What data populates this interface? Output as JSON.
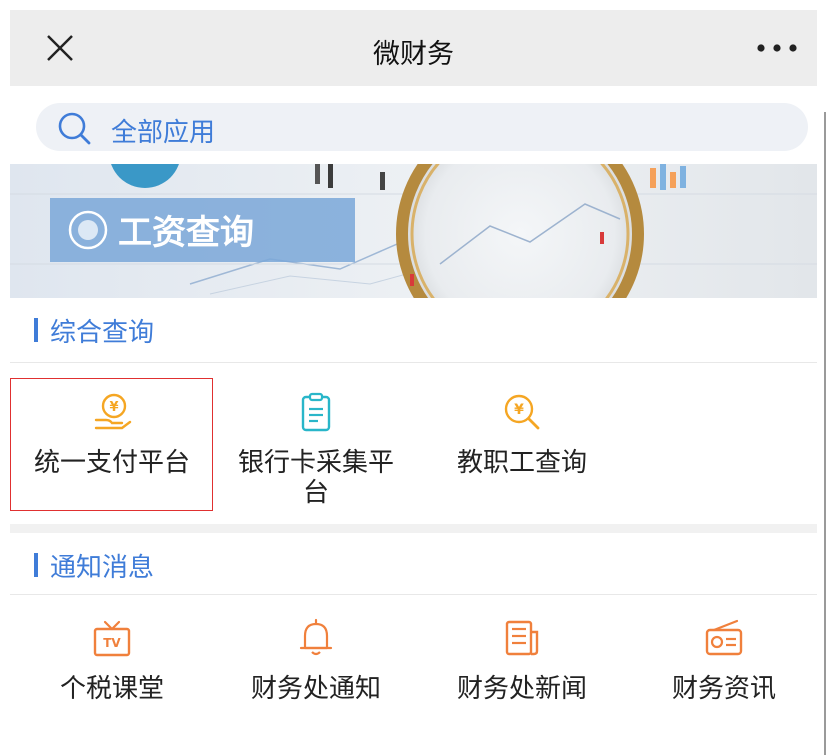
{
  "header": {
    "title": "微财务",
    "close_icon": "close-icon",
    "more_icon": "more-dots-icon"
  },
  "search": {
    "label": "全部应用",
    "icon": "search-icon"
  },
  "banner": {
    "text": "工资查询"
  },
  "sections": [
    {
      "title": "综合查询",
      "items": [
        {
          "label": "统一支付平台",
          "icon": "yuan-hand-icon",
          "color": "#f5a623"
        },
        {
          "label": "银行卡采集平台",
          "icon": "clipboard-icon",
          "color": "#29b6c9"
        },
        {
          "label": "教职工查询",
          "icon": "yuan-search-icon",
          "color": "#f5a623"
        }
      ]
    },
    {
      "title": "通知消息",
      "items": [
        {
          "label": "个税课堂",
          "icon": "tv-icon",
          "color": "#f0803c"
        },
        {
          "label": "财务处通知",
          "icon": "bell-icon",
          "color": "#f0803c"
        },
        {
          "label": "财务处新闻",
          "icon": "newspaper-icon",
          "color": "#f0803c"
        },
        {
          "label": "财务资讯",
          "icon": "radio-icon",
          "color": "#f0803c"
        }
      ]
    }
  ],
  "colors": {
    "accent": "#3f7cd8",
    "selection": "#e03030"
  }
}
